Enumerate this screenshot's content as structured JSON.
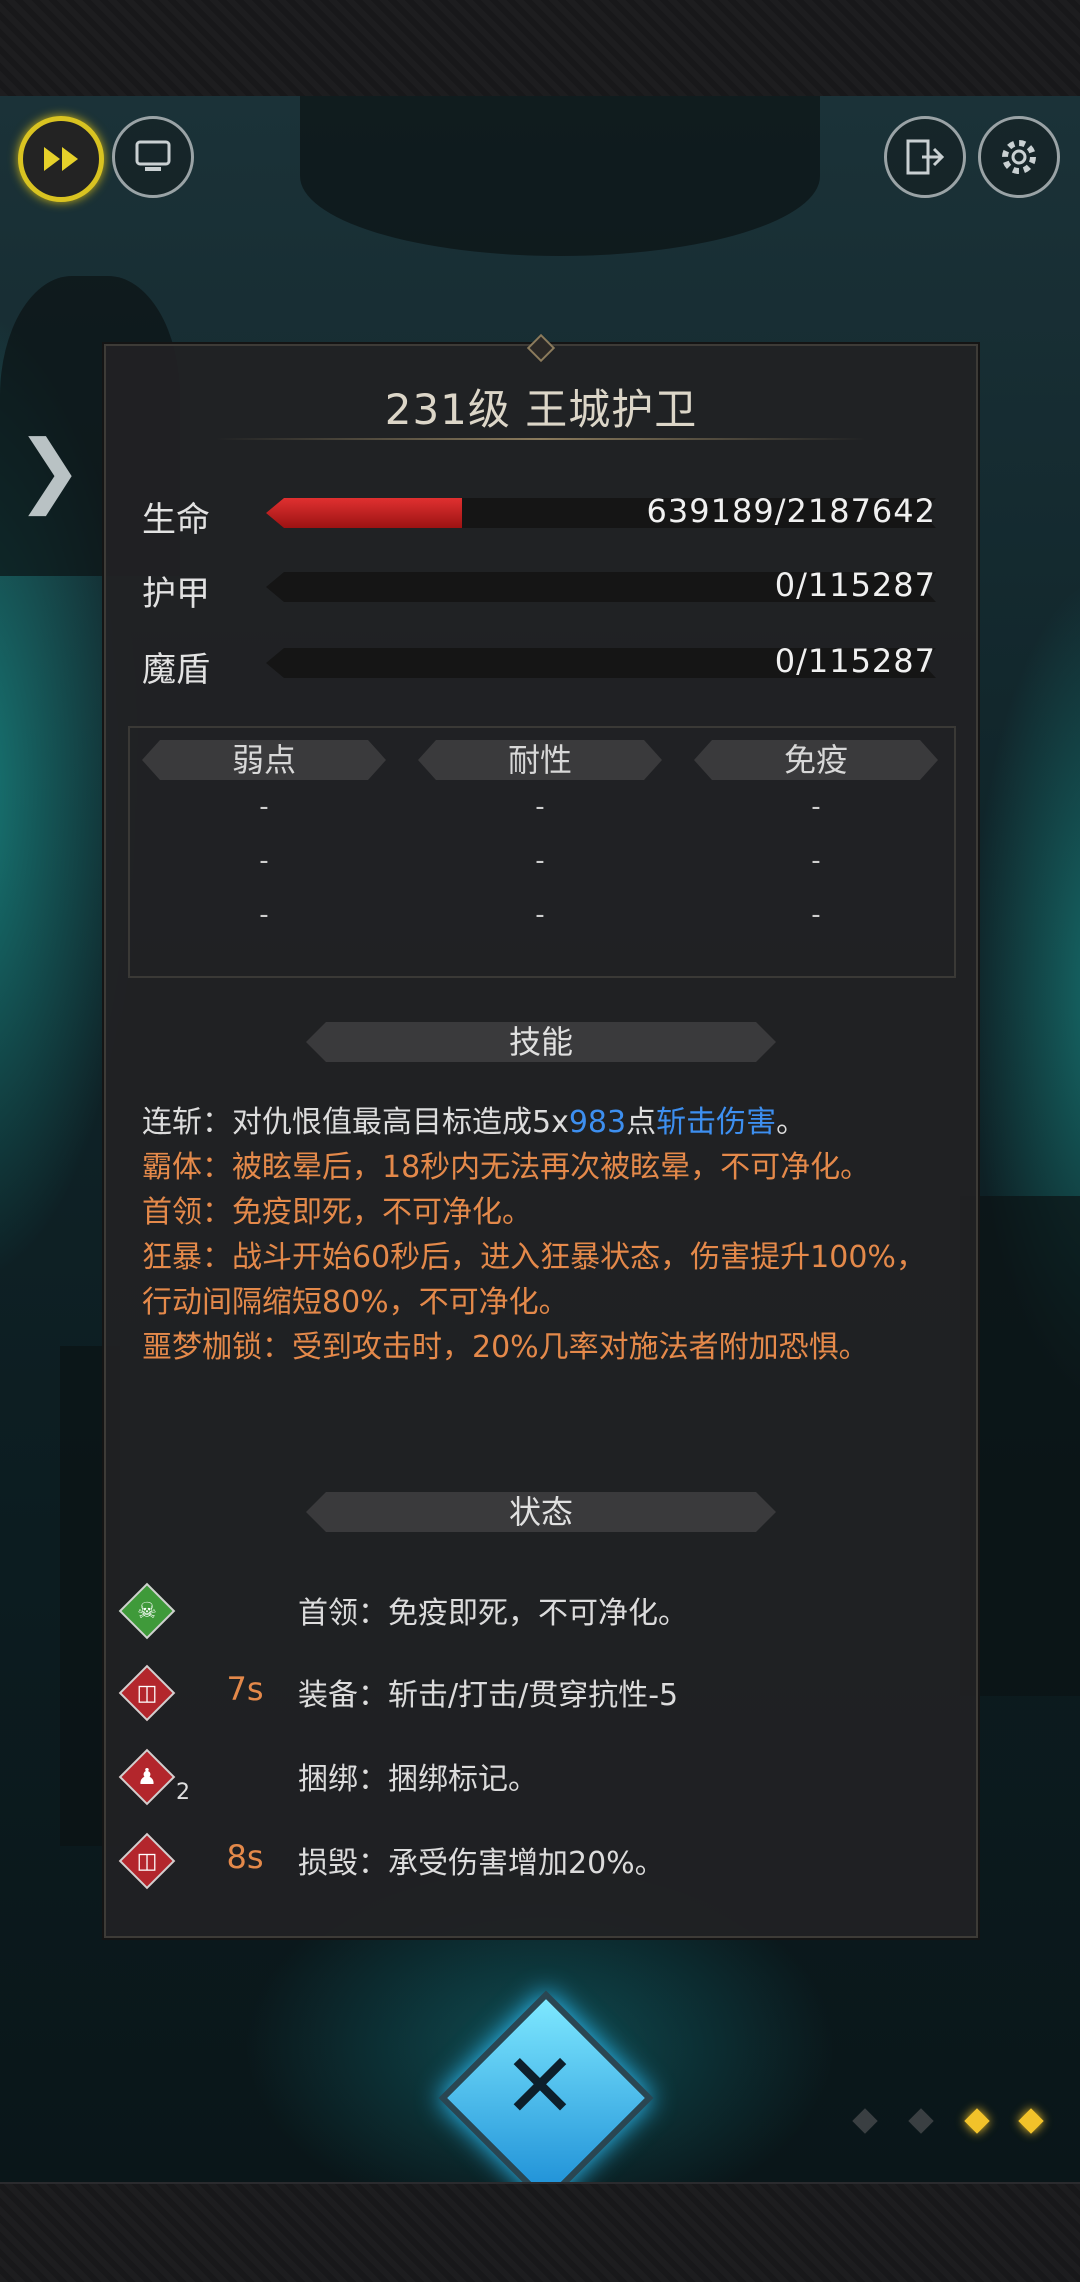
{
  "header": {
    "fast_forward_icon": "fast-forward-icon",
    "auto_icon": "auto-battle-icon",
    "exit_icon": "exit-icon",
    "settings_icon": "gear-icon"
  },
  "enemy": {
    "title": "231级  王城护卫",
    "hp_label": "生命",
    "hp_text": "639189/2187642",
    "hp_fraction": 0.292,
    "armor_label": "护甲",
    "armor_text": "0/115287",
    "armor_fraction": 0,
    "shield_label": "魔盾",
    "shield_text": "0/115287",
    "shield_fraction": 0
  },
  "resistances": {
    "headers": [
      "弱点",
      "耐性",
      "免疫"
    ],
    "rows": [
      [
        "-",
        "-",
        "-"
      ],
      [
        "-",
        "-",
        "-"
      ],
      [
        "-",
        "-",
        "-"
      ]
    ]
  },
  "skills": {
    "heading": "技能",
    "items": [
      {
        "name": "连斩：",
        "pre": "对仇恨值最高目标造成5x",
        "num": "983",
        "mid": "点",
        "link": "斩击伤害",
        "post": "。"
      },
      {
        "name": "霸体：",
        "text": "被眩晕后，18秒内无法再次被眩晕，不可净化。"
      },
      {
        "name": "首领：",
        "text": "免疫即死，不可净化。"
      },
      {
        "name": "狂暴：",
        "text": "战斗开始60秒后，进入狂暴状态，伤害提升100%，行动间隔缩短80%，不可净化。"
      },
      {
        "name": "噩梦枷锁：",
        "text": "受到攻击时，20%几率对施法者附加恐惧。"
      }
    ]
  },
  "status": {
    "heading": "状态",
    "items": [
      {
        "icon": "skull-icon",
        "color": "#3f9a3a",
        "duration": "",
        "count": "",
        "text": "首领：免疫即死，不可净化。"
      },
      {
        "icon": "shield-icon",
        "color": "#b3262c",
        "duration": "7s",
        "count": "",
        "text": "装备：斩击/打击/贯穿抗性-5"
      },
      {
        "icon": "bind-icon",
        "color": "#b3262c",
        "duration": "",
        "count": "2",
        "text": "捆绑：捆绑标记。"
      },
      {
        "icon": "shield-icon",
        "color": "#b3262c",
        "duration": "8s",
        "count": "",
        "text": "损毁：承受伤害增加20%。"
      }
    ]
  },
  "footer": {
    "close_icon": "close-icon"
  },
  "colors": {
    "hp_fill": "#c62020",
    "accent_orange": "#e4894a",
    "accent_blue": "#3d8ff0",
    "page_dot_active": "#f2c22a"
  }
}
